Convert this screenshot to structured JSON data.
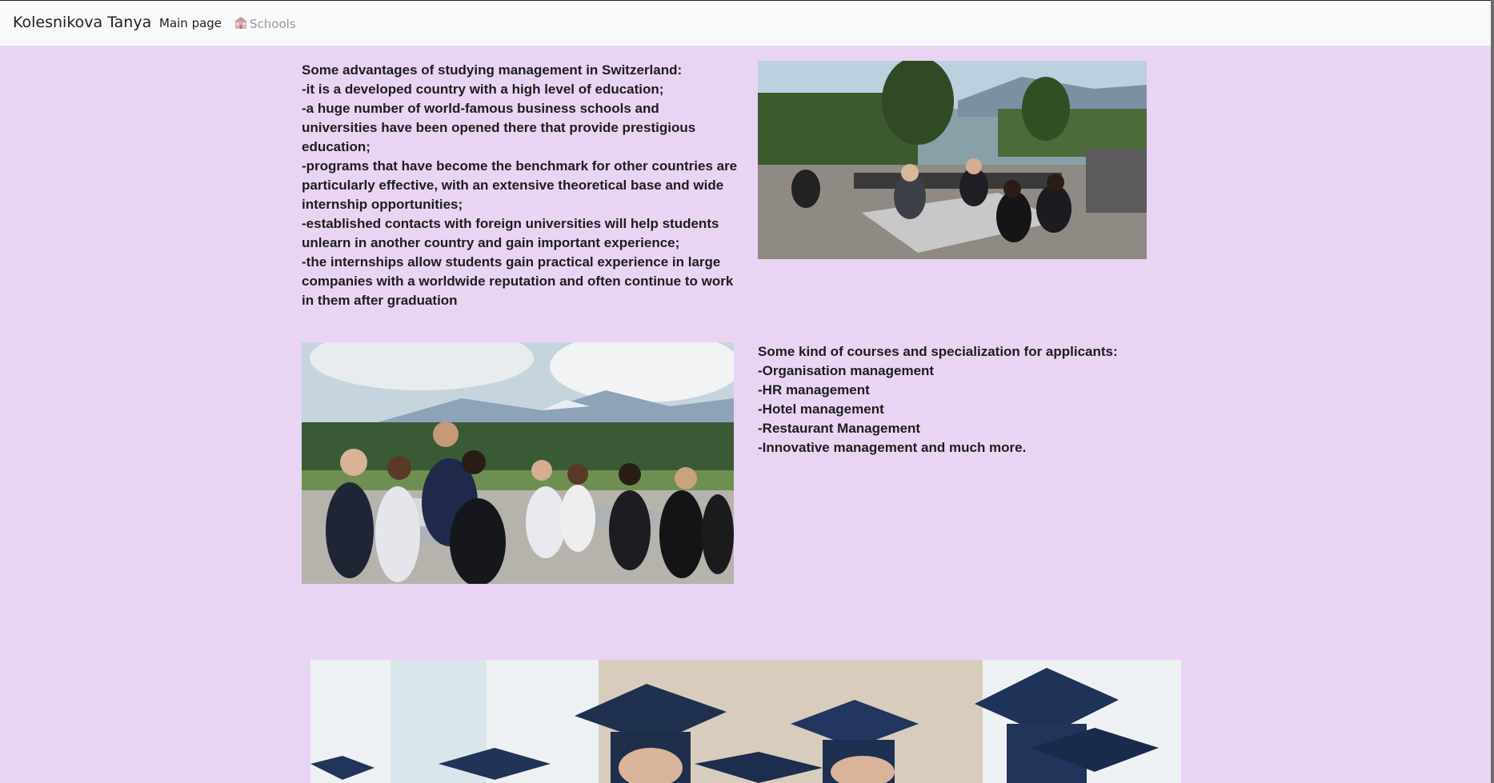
{
  "navbar": {
    "brand": "Kolesnikova Tanya",
    "main_link": "Main page",
    "schools_link": "Schools",
    "schools_icon": "school-building-icon"
  },
  "content": {
    "advantages_text": "Some advantages of studying management in Switzerland:\n-it is a developed country with a high level of education;\n-a huge number of world-famous business schools and universities have been opened there that provide prestigious education;\n-programs that have become the benchmark for other countries are particularly effective, with an extensive theoretical base and wide internship opportunities;\n-established contacts with foreign universities will help students unlearn in another country and gain important experience;\n-the internships allow students gain practical experience in large companies with a worldwide reputation and often continue to work in them after graduation",
    "courses_text": "Some kind of courses and specialization for applicants:\n-Organisation management\n-HR management\n-Hotel management\n-Restaurant Management\n-Innovative management and much more."
  },
  "colors": {
    "background": "#e9d5f3",
    "navbar": "#f8f9fa"
  }
}
